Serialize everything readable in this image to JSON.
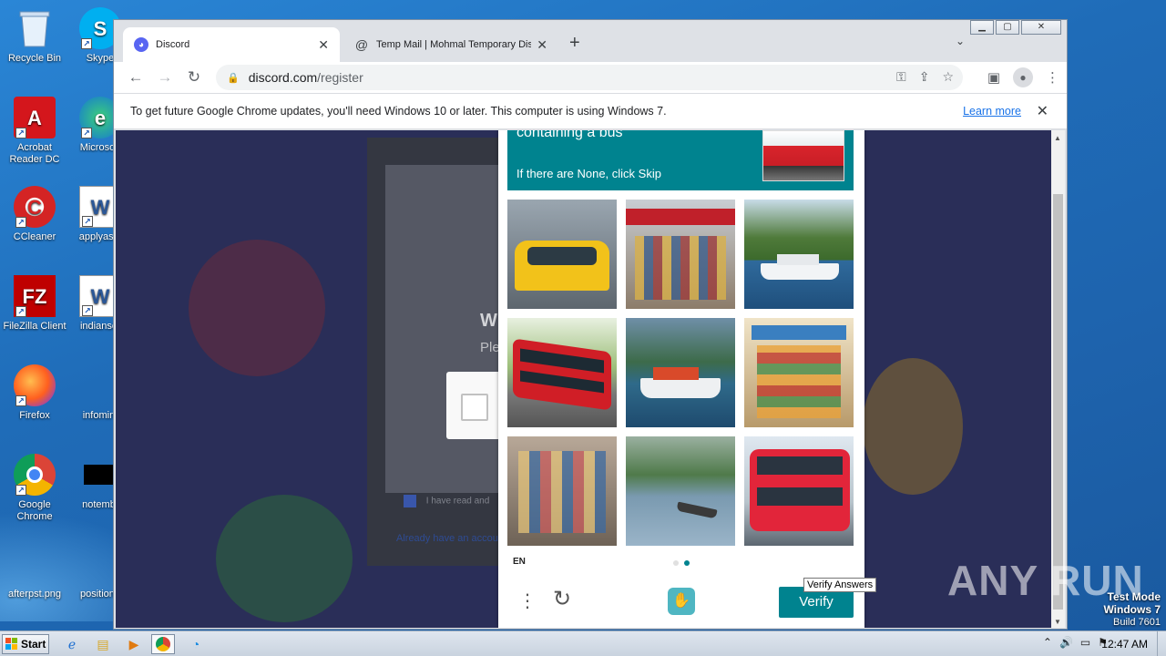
{
  "desktop": {
    "icons": [
      {
        "label": "Recycle Bin",
        "icon": "recycle-bin-icon"
      },
      {
        "label": "Skype",
        "icon": "skype-icon"
      },
      {
        "label": "Acrobat Reader DC",
        "icon": "acrobat-icon"
      },
      {
        "label": "Microsoft",
        "icon": "edge-icon"
      },
      {
        "label": "CCleaner",
        "icon": "ccleaner-icon"
      },
      {
        "label": "applyasia",
        "icon": "word-doc-icon"
      },
      {
        "label": "FileZilla Client",
        "icon": "filezilla-icon"
      },
      {
        "label": "indianset",
        "icon": "word-doc-icon"
      },
      {
        "label": "Firefox",
        "icon": "firefox-icon"
      },
      {
        "label": "infomin.",
        "icon": "file-icon"
      },
      {
        "label": "Google Chrome",
        "icon": "chrome-icon"
      },
      {
        "label": "notemb.",
        "icon": "black-file-icon"
      },
      {
        "label": "afterpst.png",
        "icon": "image-file-icon"
      },
      {
        "label": "positiond",
        "icon": "file-icon"
      }
    ]
  },
  "browser": {
    "tabs": [
      {
        "label": "Discord",
        "icon": "discord-icon",
        "active": true
      },
      {
        "label": "Temp Mail | Mohmal Temporary Dispo",
        "icon": "at-sign-icon",
        "active": false
      }
    ],
    "url_domain": "discord.com",
    "url_path": "/register",
    "infobar_text": "To get future Google Chrome updates, you'll need Windows 10 or later. This computer is using Windows 7.",
    "infobar_link": "Learn more"
  },
  "page": {
    "modal_heading_fragment": "W",
    "modal_sub_fragment": "Ple",
    "checkbox_text": "I have read and",
    "already_link": "Already have an account?"
  },
  "hcaptcha": {
    "prompt": "containing a bus",
    "hint": "If there are None, click Skip",
    "language": "EN",
    "verify_label": "Verify",
    "tooltip": "Verify Answers",
    "images": [
      {
        "subject": "taxi"
      },
      {
        "subject": "kiosk"
      },
      {
        "subject": "boat"
      },
      {
        "subject": "bus"
      },
      {
        "subject": "boat"
      },
      {
        "subject": "kiosk"
      },
      {
        "subject": "kiosk"
      },
      {
        "subject": "boat"
      },
      {
        "subject": "bus"
      }
    ],
    "page_indicator": {
      "current": 2,
      "total": 2
    }
  },
  "overlay": {
    "watermark": "ANY RUN",
    "test_mode": "Test Mode",
    "os": "Windows 7",
    "build": "Build 7601"
  },
  "taskbar": {
    "start_label": "Start",
    "clock": "12:47 AM"
  }
}
